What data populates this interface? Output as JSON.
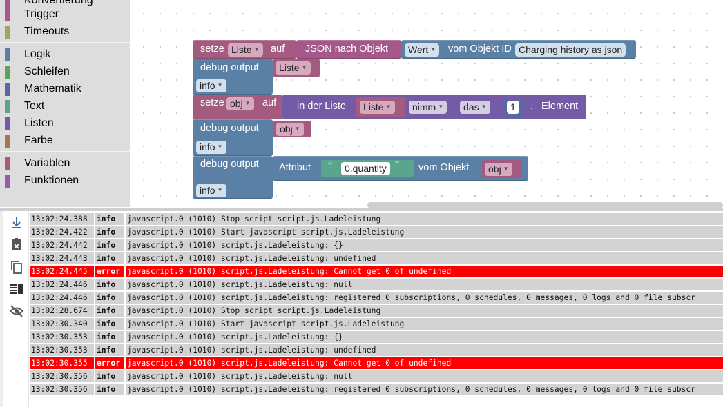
{
  "toolbox": {
    "items": [
      {
        "label": "Konvertierung",
        "color": "#a5598a"
      },
      {
        "label": "Trigger",
        "color": "#a5598a"
      },
      {
        "label": "Timeouts",
        "color": "#9fa55b"
      },
      {
        "label": "Logik",
        "color": "#5b80a5"
      },
      {
        "label": "Schleifen",
        "color": "#5ba55b"
      },
      {
        "label": "Mathematik",
        "color": "#5b67a5"
      },
      {
        "label": "Text",
        "color": "#5ba58c"
      },
      {
        "label": "Listen",
        "color": "#745ba5"
      },
      {
        "label": "Farbe",
        "color": "#a5745b"
      },
      {
        "label": "Variablen",
        "color": "#a55b80"
      },
      {
        "label": "Funktionen",
        "color": "#995ba5"
      }
    ]
  },
  "workspace": {
    "block1": {
      "set": "setze",
      "var": "Liste",
      "to": "auf",
      "json": "JSON nach Objekt",
      "value_dd": "Wert",
      "from_object": "vom Objekt ID",
      "object_id": "Charging history as json"
    },
    "block2": {
      "debug": "debug output",
      "var": "Liste",
      "level": "info"
    },
    "block3": {
      "set": "setze",
      "var": "obj",
      "to": "auf",
      "in_list": "in der Liste",
      "list_var": "Liste",
      "take": "nimm",
      "the": "das",
      "index": "1",
      "dot": ".",
      "element": "Element"
    },
    "block4": {
      "debug": "debug output",
      "var": "obj",
      "level": "info"
    },
    "block5": {
      "debug": "debug output",
      "attribute": "Attribut",
      "quote_open": "“",
      "attr_value": "0.quantity",
      "quote_close": "”",
      "from_object": "vom Objekt",
      "var": "obj",
      "level": "info"
    },
    "colors": {
      "variables": "#a55b80",
      "conversion": "#a5598a",
      "debug": "#5b80a5",
      "lists": "#745ba5",
      "text": "#5ba58c"
    }
  },
  "log": {
    "icons": [
      "scroll-to-bottom-icon",
      "clear-log-icon",
      "copy-icon",
      "pause-icon",
      "hide-icon"
    ],
    "rows": [
      {
        "time": "13:02:24.388",
        "level": "info",
        "message": "javascript.0 (1010) Stop script script.js.Ladeleistung"
      },
      {
        "time": "13:02:24.422",
        "level": "info",
        "message": "javascript.0 (1010) Start javascript script.js.Ladeleistung"
      },
      {
        "time": "13:02:24.442",
        "level": "info",
        "message": "javascript.0 (1010) script.js.Ladeleistung: {}"
      },
      {
        "time": "13:02:24.443",
        "level": "info",
        "message": "javascript.0 (1010) script.js.Ladeleistung: undefined"
      },
      {
        "time": "13:02:24.445",
        "level": "error",
        "message": "javascript.0 (1010) script.js.Ladeleistung: Cannot get 0 of undefined"
      },
      {
        "time": "13:02:24.446",
        "level": "info",
        "message": "javascript.0 (1010) script.js.Ladeleistung: null"
      },
      {
        "time": "13:02:24.446",
        "level": "info",
        "message": "javascript.0 (1010) script.js.Ladeleistung: registered 0 subscriptions, 0 schedules, 0 messages, 0 logs and 0 file subscr"
      },
      {
        "time": "13:02:28.674",
        "level": "info",
        "message": "javascript.0 (1010) Stop script script.js.Ladeleistung"
      },
      {
        "time": "13:02:30.340",
        "level": "info",
        "message": "javascript.0 (1010) Start javascript script.js.Ladeleistung"
      },
      {
        "time": "13:02:30.353",
        "level": "info",
        "message": "javascript.0 (1010) script.js.Ladeleistung: {}"
      },
      {
        "time": "13:02:30.353",
        "level": "info",
        "message": "javascript.0 (1010) script.js.Ladeleistung: undefined"
      },
      {
        "time": "13:02:30.355",
        "level": "error",
        "message": "javascript.0 (1010) script.js.Ladeleistung: Cannot get 0 of undefined"
      },
      {
        "time": "13:02:30.356",
        "level": "info",
        "message": "javascript.0 (1010) script.js.Ladeleistung: null"
      },
      {
        "time": "13:02:30.356",
        "level": "info",
        "message": "javascript.0 (1010) script.js.Ladeleistung: registered 0 subscriptions, 0 schedules, 0 messages, 0 logs and 0 file subscr"
      }
    ]
  }
}
